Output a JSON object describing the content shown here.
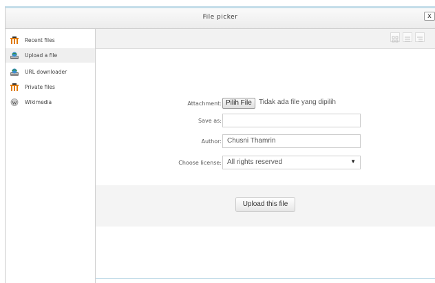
{
  "dialog": {
    "title": "File picker",
    "close_glyph": "x"
  },
  "sidebar": {
    "items": [
      {
        "label": "Recent files",
        "icon": "repository-icon"
      },
      {
        "label": "Upload a file",
        "icon": "upload-icon",
        "active": true
      },
      {
        "label": "URL downloader",
        "icon": "url-download-icon"
      },
      {
        "label": "Private files",
        "icon": "repository-icon"
      },
      {
        "label": "Wikimedia",
        "icon": "wikimedia-icon"
      }
    ]
  },
  "toolbar": {
    "view_buttons": [
      "icons-view-icon",
      "list-view-icon",
      "tree-view-icon"
    ]
  },
  "form": {
    "attachment_label": "Attachment:",
    "choose_file_label": "Pilih File",
    "file_status": "Tidak ada file yang dipilih",
    "save_as_label": "Save as:",
    "save_as_value": "",
    "author_label": "Author:",
    "author_value": "Chusni Thamrin",
    "license_label": "Choose license:",
    "license_value": "All rights reserved",
    "upload_button": "Upload this file"
  },
  "colors": {
    "accent_border": "#c4dde9",
    "repository_icon": "#e07b00"
  }
}
